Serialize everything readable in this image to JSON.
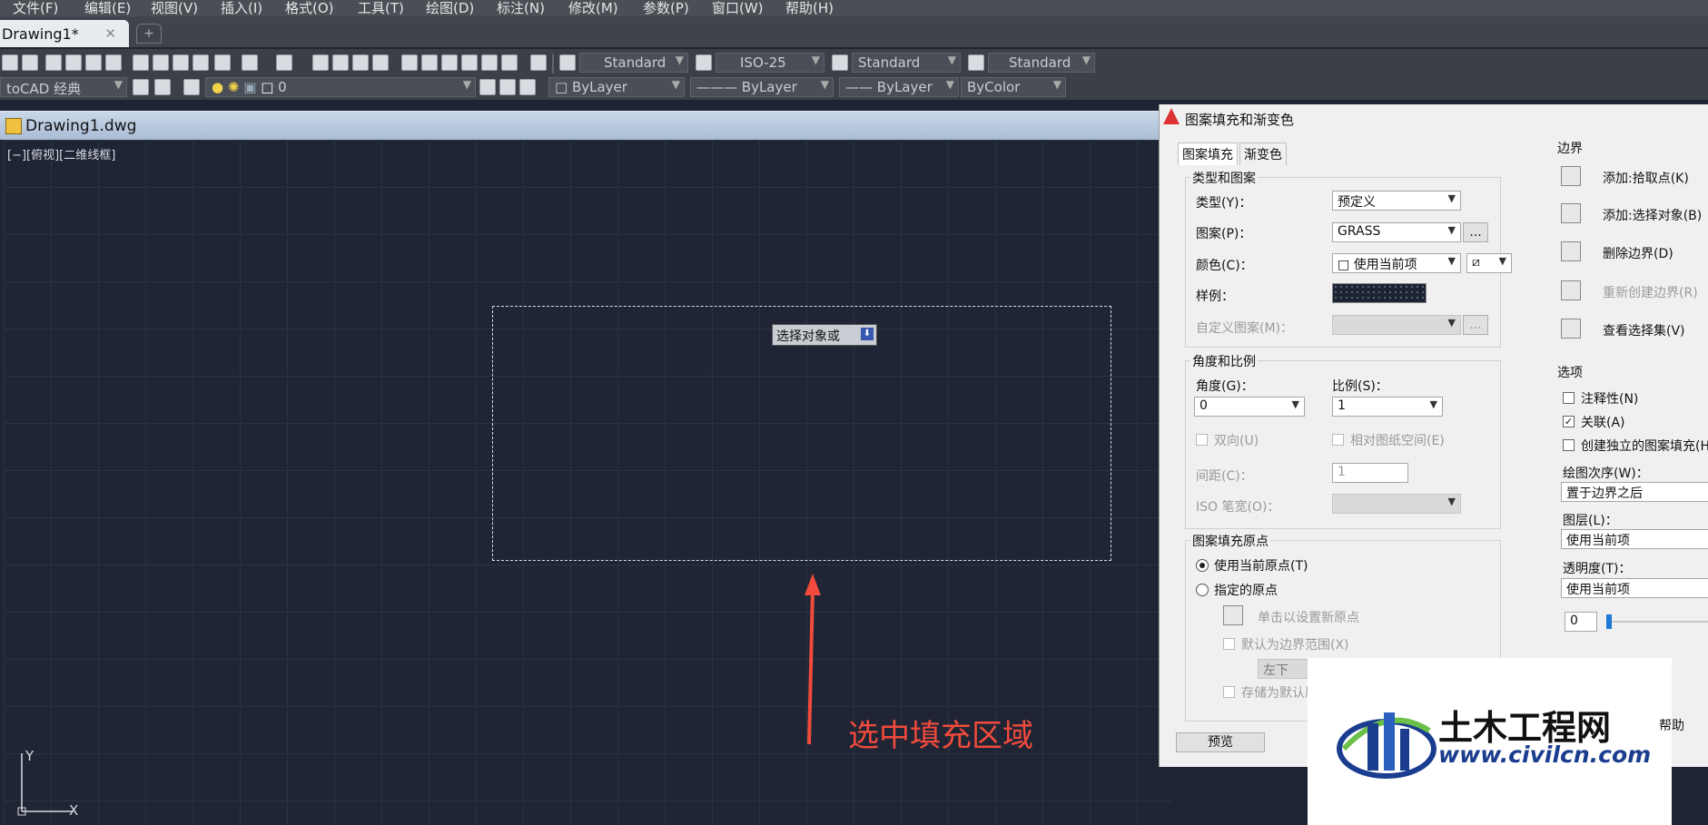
{
  "menu": [
    "文件(F)",
    "编辑(E)",
    "视图(V)",
    "插入(I)",
    "格式(O)",
    "工具(T)",
    "绘图(D)",
    "标注(N)",
    "修改(M)",
    "参数(P)",
    "窗口(W)",
    "帮助(H)"
  ],
  "tabs": {
    "doc": "Drawing1*",
    "close": "✕",
    "new": "+"
  },
  "toolbar1": {
    "text_style": "Standard",
    "dim_style": "ISO-25",
    "table_style": "Standard",
    "mleader_style": "Standard"
  },
  "toolbar2": {
    "workspace": "toCAD 经典",
    "layer": "0",
    "color": "ByLayer",
    "linetype": "ByLayer",
    "lineweight": "ByLayer",
    "plotstyle": "ByColor"
  },
  "drawing": {
    "title": "Drawing1.dwg",
    "viewport_label": "[−][俯视][二维线框]",
    "tooltip": "选择对象或",
    "annotation": "选中填充区域",
    "ucs_y": "Y",
    "ucs_x": "X"
  },
  "dialog": {
    "title": "图案填充和渐变色",
    "tabs": [
      "图案填充",
      "渐变色"
    ],
    "type_group": {
      "title": "类型和图案",
      "type_label": "类型(Y)：",
      "type_value": "预定义",
      "pattern_label": "图案(P)：",
      "pattern_value": "GRASS",
      "color_label": "颜色(C)：",
      "color_value": "使用当前项",
      "sample_label": "样例：",
      "custom_label": "自定义图案(M)：",
      "ellipsis": "..."
    },
    "angle_group": {
      "title": "角度和比例",
      "angle_label": "角度(G)：",
      "angle_value": "0",
      "scale_label": "比例(S)：",
      "scale_value": "1",
      "double_label": "双向(U)",
      "relative_label": "相对图纸空间(E)",
      "spacing_label": "间距(C)：",
      "spacing_value": "1",
      "iso_label": "ISO 笔宽(O)："
    },
    "origin_group": {
      "title": "图案填充原点",
      "current_origin": "使用当前原点(T)",
      "specified_origin": "指定的原点",
      "click_set": "单击以设置新原点",
      "default_extent": "默认为边界范围(X)",
      "position": "左下",
      "store_default": "存储为默认原点(F)"
    },
    "boundary": {
      "title": "边界",
      "add_pick": "添加:拾取点(K)",
      "add_select": "添加:选择对象(B)",
      "remove": "删除边界(D)",
      "recreate": "重新创建边界(R)",
      "view_sel": "查看选择集(V)"
    },
    "options": {
      "title": "选项",
      "annotative": "注释性(N)",
      "associative": "关联(A)",
      "separate": "创建独立的图案填充(H)",
      "draw_order_label": "绘图次序(W)：",
      "draw_order_value": "置于边界之后",
      "layer_label": "图层(L)：",
      "layer_value": "使用当前项",
      "transparency_label": "透明度(T)：",
      "transparency_value": "使用当前项",
      "transparency_num": "0"
    },
    "preview_button": "预览",
    "help_button": "帮助"
  },
  "watermark": {
    "cn": "土木工程网",
    "url": "www.civilcn.com"
  },
  "colors": {
    "canvas": "#1f2534",
    "annotation": "#f24a3c",
    "dialog": "#f0f0f0"
  }
}
